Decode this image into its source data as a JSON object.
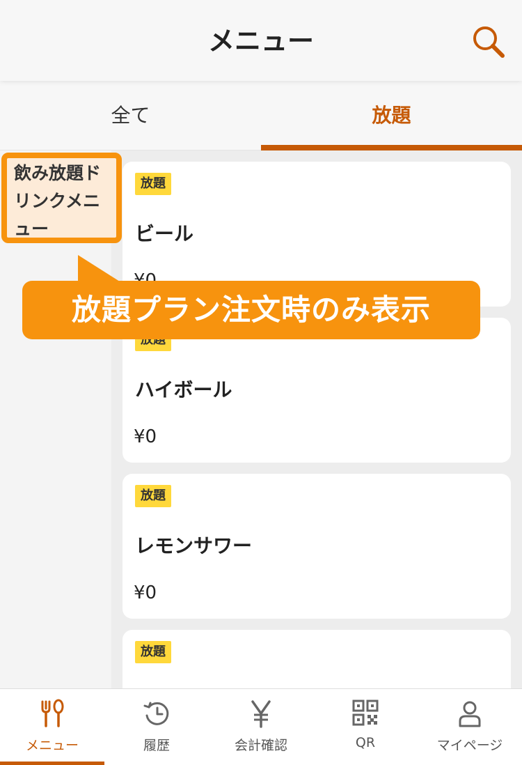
{
  "header": {
    "title": "メニュー",
    "search_icon": "search-icon"
  },
  "tabs": [
    {
      "label": "全て",
      "selected": false
    },
    {
      "label": "放題",
      "selected": true
    }
  ],
  "sidebar": {
    "categories": [
      {
        "label": "飲み放題ドリンクメニュー",
        "selected": true
      }
    ]
  },
  "items": [
    {
      "badge": "放題",
      "name": "ビール",
      "price": "¥0"
    },
    {
      "badge": "放題",
      "name": "ハイボール",
      "price": "¥0"
    },
    {
      "badge": "放題",
      "name": "レモンサワー",
      "price": "¥0"
    },
    {
      "badge": "放題",
      "name": "",
      "price": ""
    }
  ],
  "callout": {
    "text": "放題プラン注文時のみ表示"
  },
  "bottom_nav": [
    {
      "label": "メニュー",
      "icon": "fork-knife-icon",
      "active": true
    },
    {
      "label": "履歴",
      "icon": "history-icon",
      "active": false
    },
    {
      "label": "会計確認",
      "icon": "yen-icon",
      "active": false
    },
    {
      "label": "QR",
      "icon": "qr-code-icon",
      "active": false
    },
    {
      "label": "マイページ",
      "icon": "person-icon",
      "active": false
    }
  ],
  "colors": {
    "accent": "#c65a06",
    "callout": "#f7930e",
    "badge": "#ffd83b",
    "category_bg": "#fdebd8"
  }
}
